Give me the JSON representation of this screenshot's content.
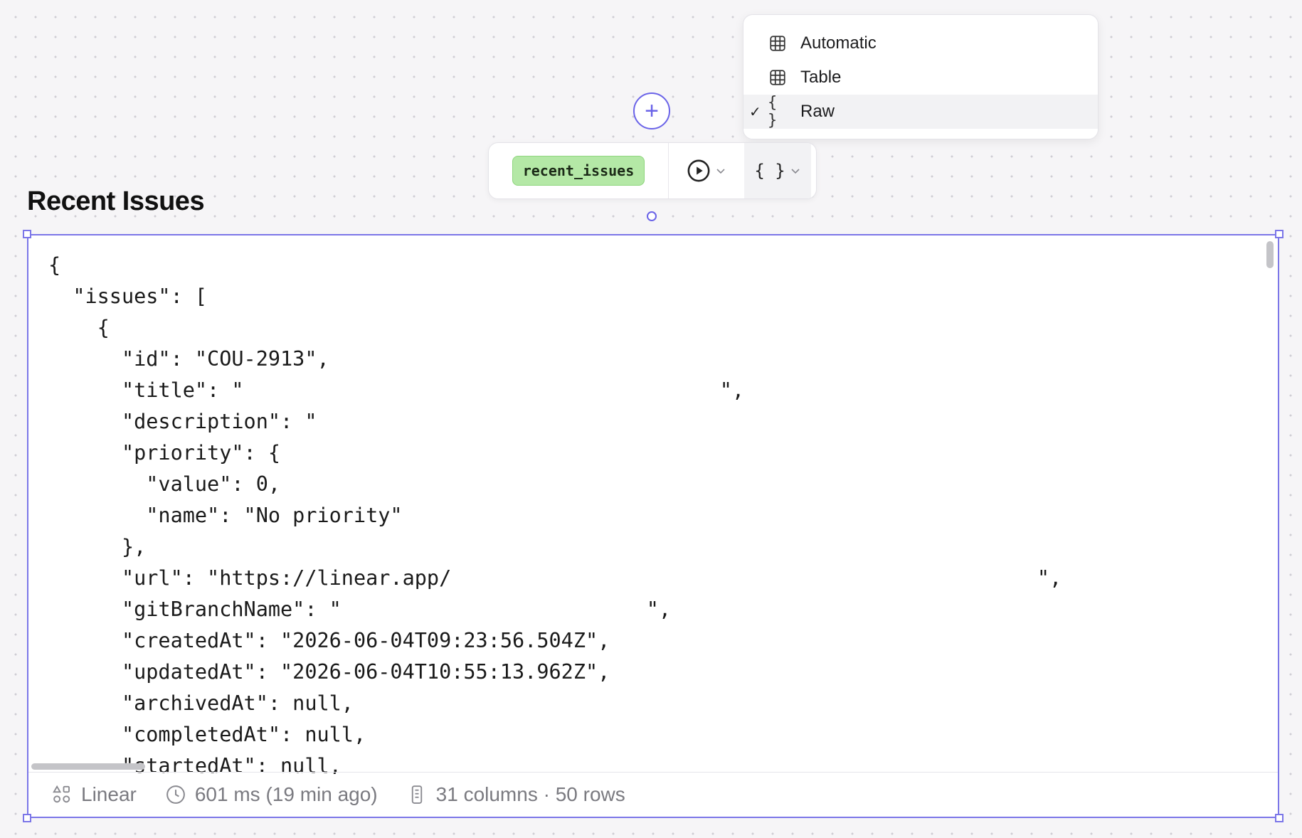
{
  "format_menu": {
    "items": [
      {
        "label": "Automatic",
        "icon": "grid-icon",
        "selected": false
      },
      {
        "label": "Table",
        "icon": "grid-icon",
        "selected": false
      },
      {
        "label": "Raw",
        "icon": "braces-icon",
        "icon_text": "{ }",
        "selected": true
      }
    ],
    "check_glyph": "✓"
  },
  "add_button": {
    "glyph": "+"
  },
  "toolbar": {
    "query_name": "recent_issues",
    "format_glyph": "{ }"
  },
  "block": {
    "title": "Recent Issues"
  },
  "raw_output": {
    "lines": [
      "{",
      "  \"issues\": [",
      "    {",
      "      \"id\": \"COU-2913\",",
      "      \"title\": \"                                       \",",
      "      \"description\": \"",
      "      \"priority\": {",
      "        \"value\": 0,",
      "        \"name\": \"No priority\"",
      "      },",
      "      \"url\": \"https://linear.app/                                                \",",
      "      \"gitBranchName\": \"                         \",",
      "      \"createdAt\": \"2026-06-04T09:23:56.504Z\",",
      "      \"updatedAt\": \"2026-06-04T10:55:13.962Z\",",
      "      \"archivedAt\": null,",
      "      \"completedAt\": null,",
      "      \"startedAt\": null,"
    ]
  },
  "footer": {
    "source": "Linear",
    "timing": "601 ms (19 min ago)",
    "shape": "31 columns · 50 rows"
  },
  "colors": {
    "accent": "#6a63e8",
    "chip_bg": "#b4e8a6",
    "canvas_bg": "#f6f5f7"
  }
}
